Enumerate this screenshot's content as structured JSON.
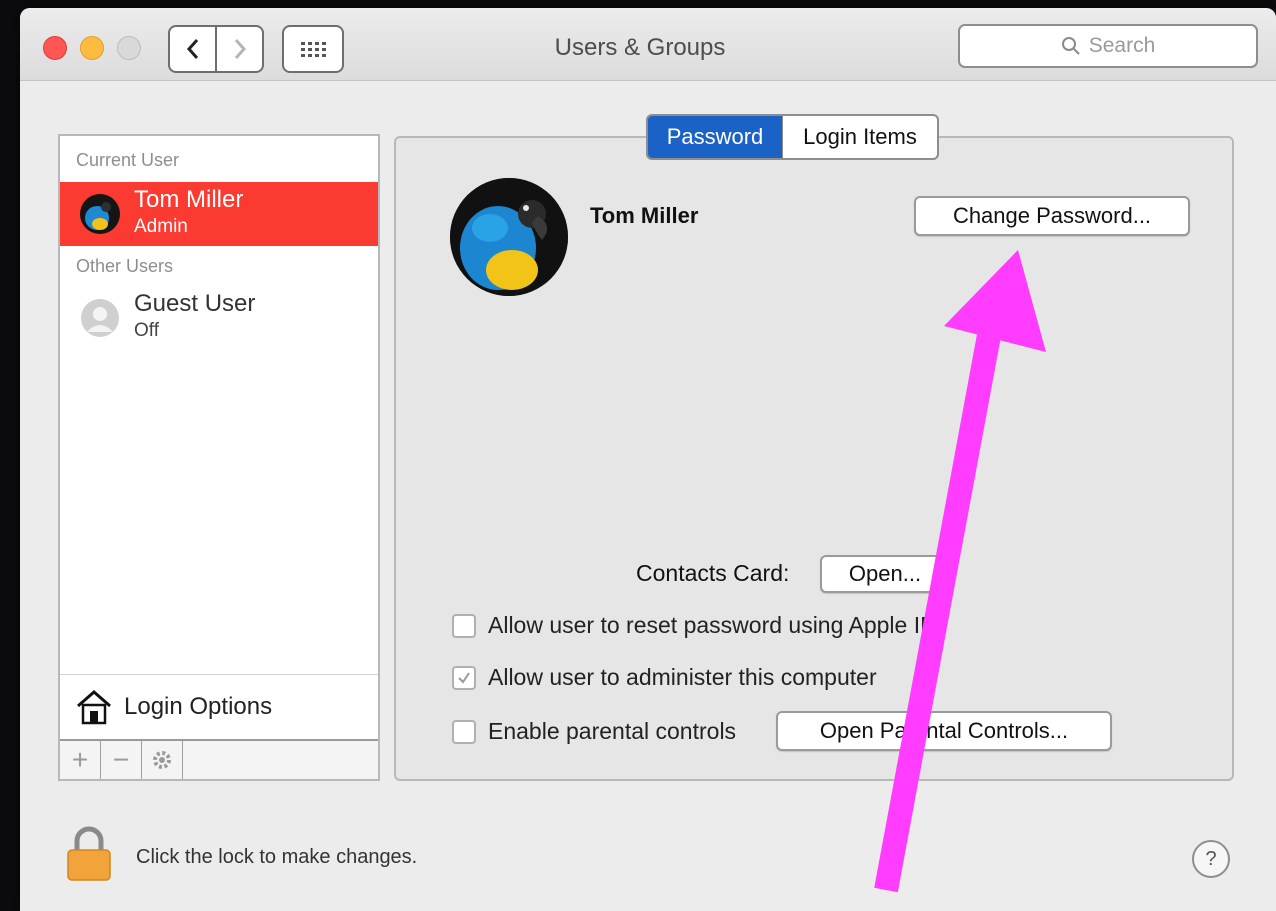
{
  "window": {
    "title": "Users & Groups"
  },
  "toolbar": {
    "back_icon": "chevron-left-icon",
    "forward_icon": "chevron-right-icon",
    "grid_icon": "grid-icon",
    "search_placeholder": "Search"
  },
  "sidebar": {
    "current_user_label": "Current User",
    "current_user": {
      "name": "Tom Miller",
      "role": "Admin"
    },
    "other_users_label": "Other Users",
    "other_users": [
      {
        "name": "Guest User",
        "status": "Off"
      }
    ],
    "login_options_label": "Login Options",
    "add_label": "+",
    "remove_label": "−"
  },
  "tabs": [
    {
      "label": "Password"
    },
    {
      "label": "Login Items"
    }
  ],
  "main": {
    "user_name": "Tom Miller",
    "change_password_label": "Change Password...",
    "contacts_card_label": "Contacts Card:",
    "open_label": "Open...",
    "checkboxes": [
      {
        "label": "Allow user to reset password using Apple ID",
        "checked": false
      },
      {
        "label": "Allow user to administer this computer",
        "checked": true
      },
      {
        "label": "Enable parental controls",
        "checked": false
      }
    ],
    "open_parental_controls_label": "Open Parental Controls..."
  },
  "footer": {
    "lock_text": "Click the lock to make changes.",
    "help_label": "?"
  },
  "colors": {
    "selection": "#fb3b32",
    "tab_active": "#1b62c6",
    "annotation_arrow": "#ff3cff"
  }
}
